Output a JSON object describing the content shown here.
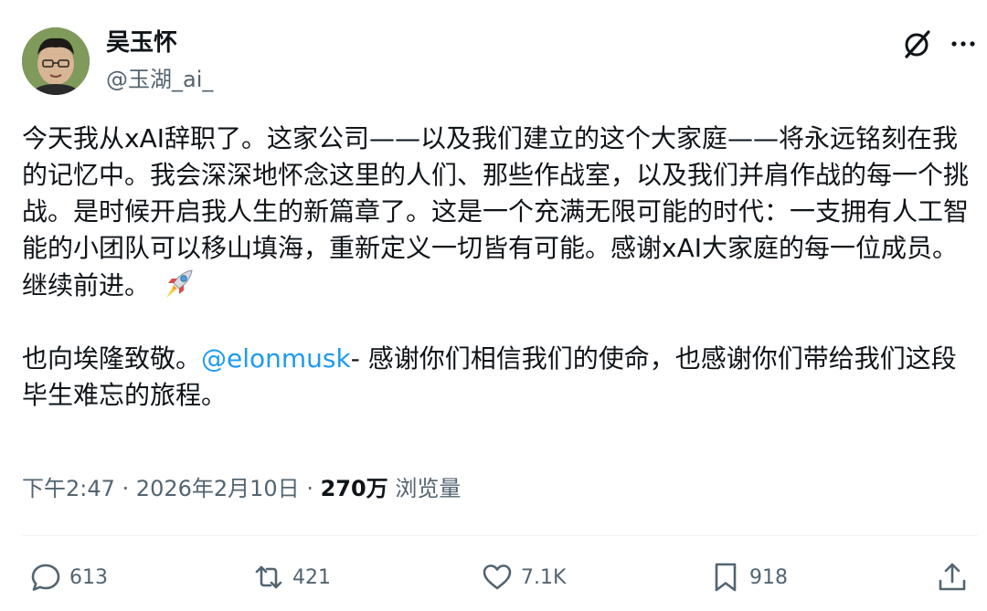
{
  "author": {
    "display_name": "吴玉怀",
    "handle": "@玉湖_ai_"
  },
  "tweet": {
    "paragraph1": "今天我从xAI辞职了。这家公司——以及我们建立的这个大家庭——将永远铭刻在我的记忆中。我会深深地怀念这里的人们、那些作战室，以及我们并肩作战的每一个挑战。是时候开启我人生的新篇章了。这是一个充满无限可能的时代：一支拥有人工智能的小团队可以移山填海，重新定义一切皆有可能。感谢xAI大家庭的每一位成员。继续前进。",
    "paragraph2_prefix": "也向埃隆致敬。",
    "mention": "@elonmusk",
    "paragraph2_suffix": "- 感谢你们相信我们的使命，也感谢你们带给我们这段毕生难忘的旅程。",
    "emoji": "rocket-emoji"
  },
  "meta": {
    "time": "下午2:47",
    "separator": " · ",
    "date": "2026年2月10日",
    "views_count": "270万",
    "views_label": "浏览量"
  },
  "actions": {
    "replies": "613",
    "retweets": "421",
    "likes": "7.1K",
    "bookmarks": "918"
  },
  "colors": {
    "mention": "#1d9bf0",
    "secondary_text": "#536471",
    "primary_text": "#0f1419"
  }
}
